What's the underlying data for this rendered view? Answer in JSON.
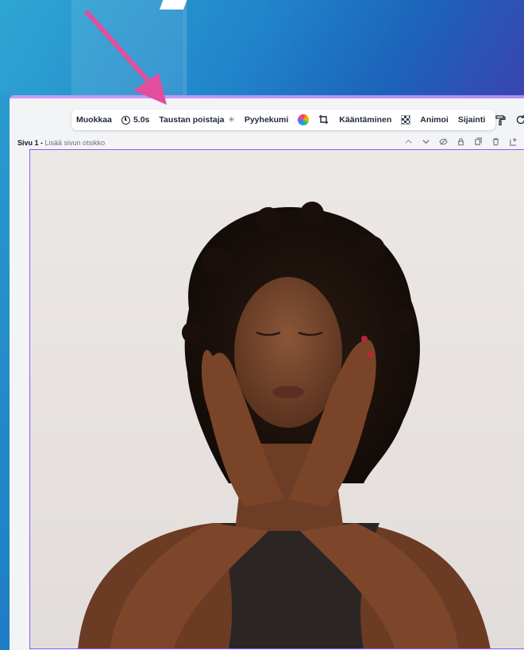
{
  "toolbar": {
    "edit_label": "Muokkaa",
    "duration_label": "5.0s",
    "bg_remover_label": "Taustan poistaja",
    "eraser_label": "Pyyhekumi",
    "flip_label": "Kääntäminen",
    "animate_label": "Animoi",
    "position_label": "Sijainti"
  },
  "page": {
    "number_label": "Sivu 1 -",
    "title_placeholder": "Lisää sivun otsikko"
  },
  "colors": {
    "accent": "#8b5cf6",
    "arrow": "#e24e9c"
  }
}
